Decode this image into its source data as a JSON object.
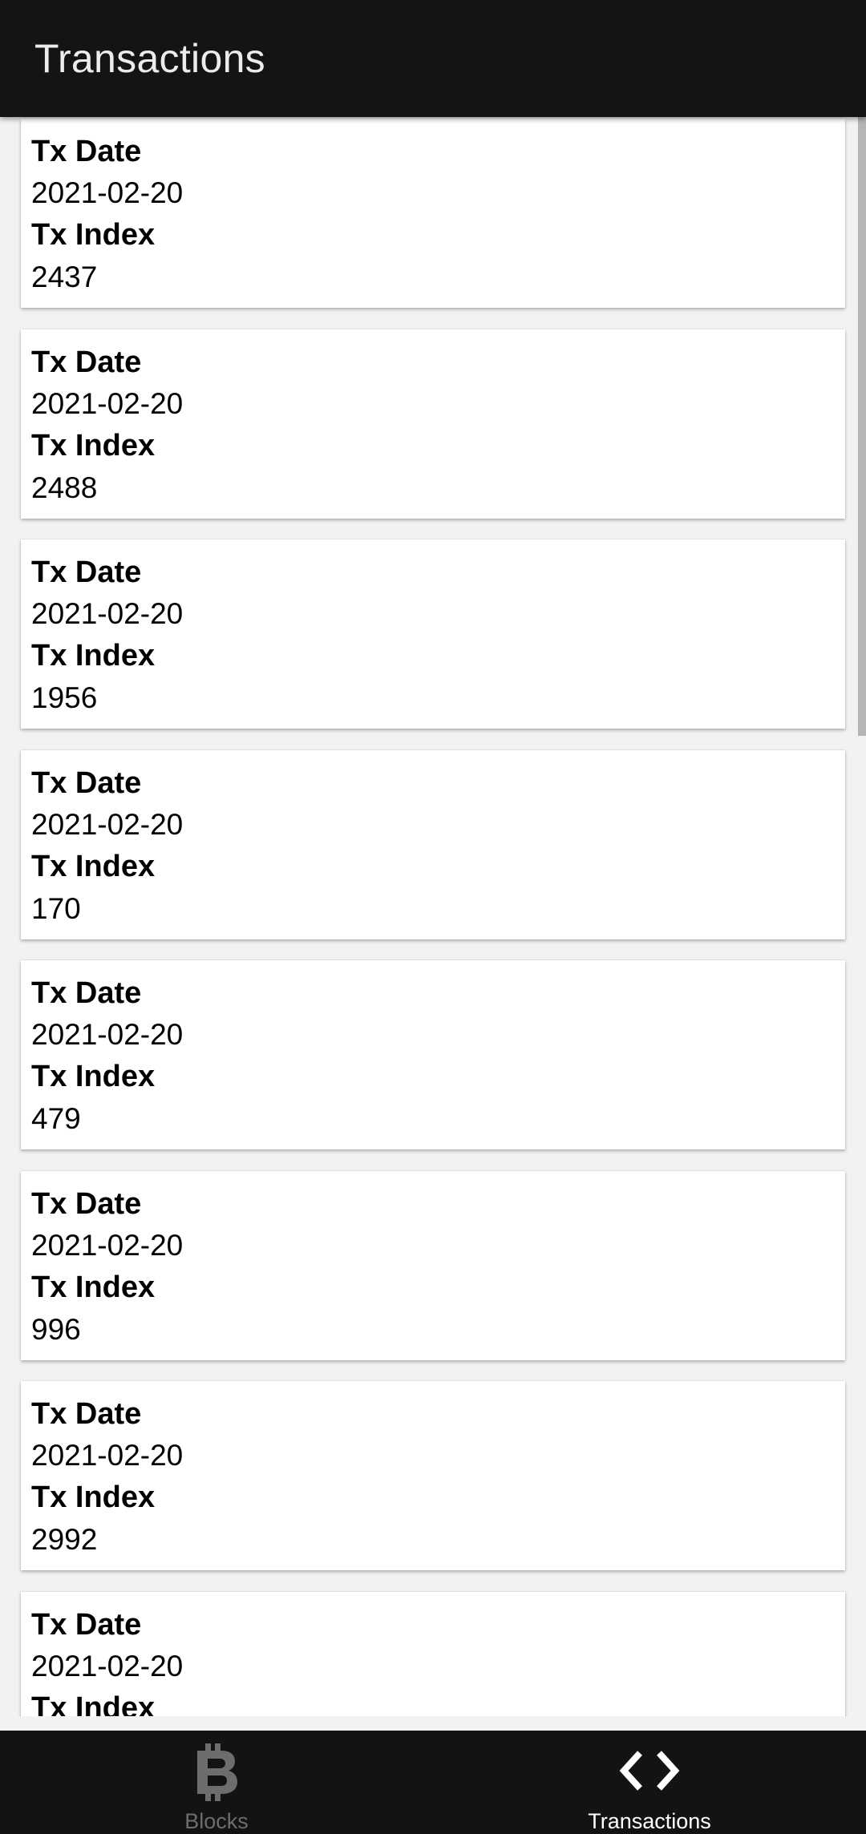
{
  "app_bar": {
    "title": "Transactions"
  },
  "transactions": [
    {
      "date_label": "Tx Date",
      "date": "2021-02-20",
      "index_label": "Tx Index",
      "index": "2437"
    },
    {
      "date_label": "Tx Date",
      "date": "2021-02-20",
      "index_label": "Tx Index",
      "index": "2488"
    },
    {
      "date_label": "Tx Date",
      "date": "2021-02-20",
      "index_label": "Tx Index",
      "index": "1956"
    },
    {
      "date_label": "Tx Date",
      "date": "2021-02-20",
      "index_label": "Tx Index",
      "index": "170"
    },
    {
      "date_label": "Tx Date",
      "date": "2021-02-20",
      "index_label": "Tx Index",
      "index": "479"
    },
    {
      "date_label": "Tx Date",
      "date": "2021-02-20",
      "index_label": "Tx Index",
      "index": "996"
    },
    {
      "date_label": "Tx Date",
      "date": "2021-02-20",
      "index_label": "Tx Index",
      "index": "2992"
    },
    {
      "date_label": "Tx Date",
      "date": "2021-02-20",
      "index_label": "Tx Index",
      "index": ""
    }
  ],
  "bottom_nav": {
    "items": [
      {
        "label": "Blocks",
        "icon": "bitcoin-icon",
        "active": false
      },
      {
        "label": "Transactions",
        "icon": "code-brackets-icon",
        "active": true
      }
    ]
  },
  "colors": {
    "app_bar_bg": "#141414",
    "page_bg": "#f2f2f2",
    "card_bg": "#ffffff",
    "nav_bg": "#131313",
    "nav_active": "#ffffff",
    "nav_inactive": "#6d6d6d"
  }
}
